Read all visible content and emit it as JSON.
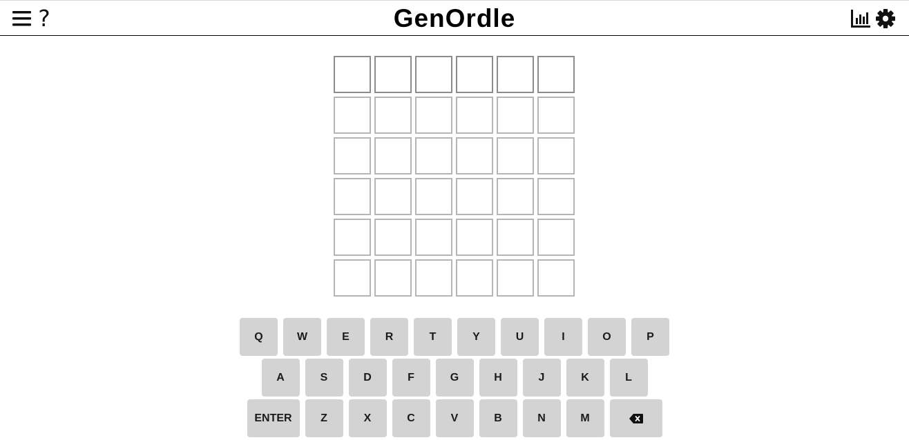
{
  "app": {
    "title": "GenOrdle"
  },
  "header": {
    "menu_icon": "hamburger-menu-icon",
    "help_label": "?",
    "stats_icon": "bar-chart-icon",
    "settings_icon": "gear-icon"
  },
  "board": {
    "rows": 6,
    "columns": 6,
    "tiles": [
      [
        "",
        "",
        "",
        "",
        "",
        ""
      ],
      [
        "",
        "",
        "",
        "",
        "",
        ""
      ],
      [
        "",
        "",
        "",
        "",
        "",
        ""
      ],
      [
        "",
        "",
        "",
        "",
        "",
        ""
      ],
      [
        "",
        "",
        "",
        "",
        "",
        ""
      ],
      [
        "",
        "",
        "",
        "",
        "",
        ""
      ]
    ]
  },
  "keyboard": {
    "row1": [
      "Q",
      "W",
      "E",
      "R",
      "T",
      "Y",
      "U",
      "I",
      "O",
      "P"
    ],
    "row2": [
      "A",
      "S",
      "D",
      "F",
      "G",
      "H",
      "J",
      "K",
      "L"
    ],
    "row3": [
      "ENTER",
      "Z",
      "X",
      "C",
      "V",
      "B",
      "N",
      "M"
    ],
    "backspace_icon": "backspace-icon",
    "key_color": "#d3d3d3"
  },
  "colors": {
    "tile_border": "#b5b5b5",
    "header_border": "#000000",
    "background": "#ffffff"
  }
}
